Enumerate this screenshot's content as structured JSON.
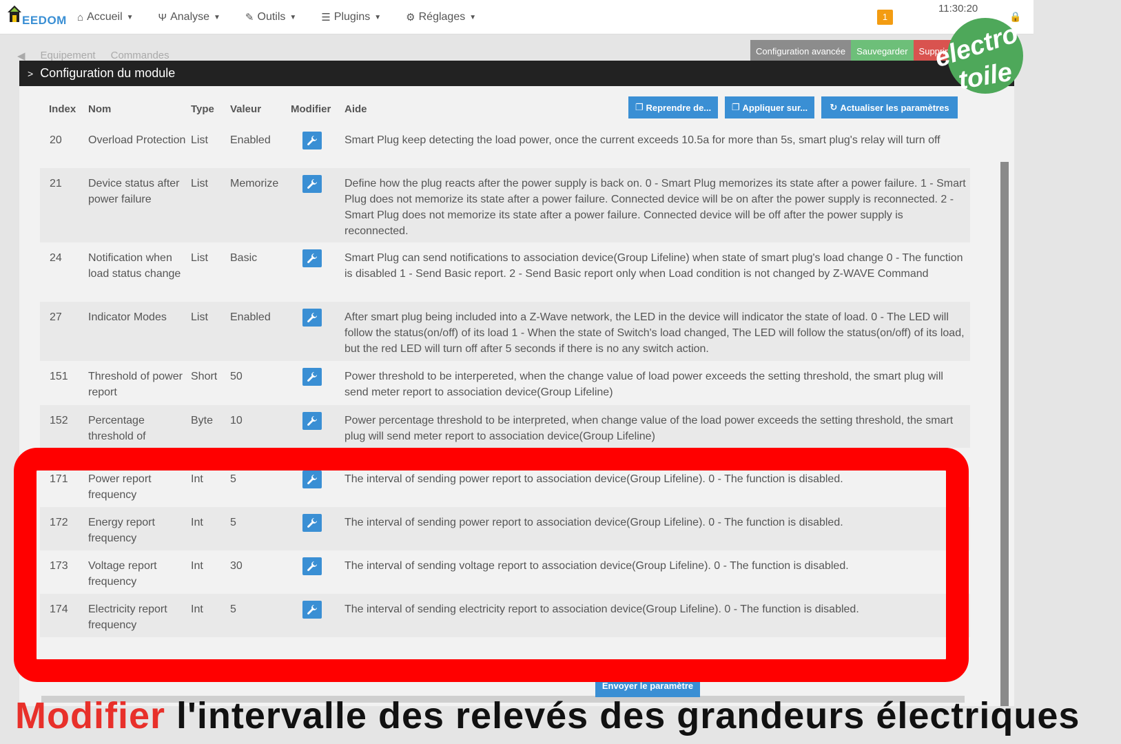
{
  "navbar": {
    "brand": "EEDOM",
    "menu": [
      {
        "label": "Accueil",
        "icon": "home-icon"
      },
      {
        "label": "Analyse",
        "icon": "stethoscope-icon"
      },
      {
        "label": "Outils",
        "icon": "wrench-icon"
      },
      {
        "label": "Plugins",
        "icon": "list-icon"
      },
      {
        "label": "Réglages",
        "icon": "gear-icon"
      }
    ],
    "notification_count": "1",
    "time": "11:30:20"
  },
  "background": {
    "tabs": [
      "Equipement",
      "Commandes"
    ],
    "buttons": [
      "Configuration avancée",
      "Sauvegarder",
      "Supprimer"
    ]
  },
  "modal": {
    "title": "Configuration du module",
    "columns": {
      "index": "Index",
      "nom": "Nom",
      "type": "Type",
      "valeur": "Valeur",
      "modifier": "Modifier",
      "aide": "Aide"
    },
    "actions": {
      "reprendre": "Reprendre de...",
      "appliquer": "Appliquer sur...",
      "actualiser": "Actualiser les paramètres"
    },
    "rows": [
      {
        "index": "20",
        "nom": "Overload Protection",
        "type": "List",
        "valeur": "Enabled",
        "aide": "Smart Plug keep detecting the load power, once the current exceeds 10.5a for more than 5s, smart plug's relay will turn off"
      },
      {
        "index": "21",
        "nom": "Device status after power failure",
        "type": "List",
        "valeur": "Memorize",
        "aide": "Define how the plug reacts after the power supply is back on. 0 - Smart Plug memorizes its state after a power failure. 1 - Smart Plug does not memorize its state after a power failure. Connected device will be on after the power supply is reconnected. 2 - Smart Plug does not memorize its state after a power failure. Connected device will be off after the power supply is reconnected."
      },
      {
        "index": "24",
        "nom": "Notification when load status change",
        "type": "List",
        "valeur": "Basic",
        "aide": "Smart Plug can send notifications to association device(Group Lifeline) when state of smart plug's load change 0 - The function is disabled 1 - Send Basic report. 2 - Send Basic report only when Load condition is not changed by Z-WAVE Command"
      },
      {
        "index": "27",
        "nom": "Indicator Modes",
        "type": "List",
        "valeur": "Enabled",
        "aide": "After smart plug being included into a Z-Wave network, the LED in the device will indicator the state of load. 0 - The LED will follow the status(on/off) of its load 1 - When the state of Switch's load changed, The LED will follow the status(on/off) of its load, but the red LED will turn off after 5 seconds if there is no any switch action."
      },
      {
        "index": "151",
        "nom": "Threshold of power report",
        "type": "Short",
        "valeur": "50",
        "aide": "Power threshold to be interpereted, when the change value of load power exceeds the setting threshold, the smart plug will send meter report to association device(Group Lifeline)"
      },
      {
        "index": "152",
        "nom": "Percentage threshold of",
        "type": "Byte",
        "valeur": "10",
        "aide": "Power percentage threshold to be interpreted, when change value of the load power exceeds the setting threshold, the smart plug will send meter report to association device(Group Lifeline)"
      },
      {
        "index": "171",
        "nom": "Power report frequency",
        "type": "Int",
        "valeur": "5",
        "aide": "The interval of sending power report to association device(Group Lifeline). 0 - The function is disabled."
      },
      {
        "index": "172",
        "nom": "Energy report frequency",
        "type": "Int",
        "valeur": "5",
        "aide": "The interval of sending power report to association device(Group Lifeline). 0 - The function is disabled."
      },
      {
        "index": "173",
        "nom": "Voltage report frequency",
        "type": "Int",
        "valeur": "30",
        "aide": "The interval of sending voltage report to association device(Group Lifeline). 0 - The function is disabled."
      },
      {
        "index": "174",
        "nom": "Electricity report frequency",
        "type": "Int",
        "valeur": "5",
        "aide": "The interval of sending electricity report to association device(Group Lifeline). 0 - The function is disabled."
      }
    ],
    "send_button": "Envoyer le paramètre"
  },
  "watermark": {
    "line1": "electro",
    "line2": "toile"
  },
  "caption": {
    "highlight": "Modifier",
    "rest": " l'intervalle des relevés des grandeurs électriques"
  },
  "colors": {
    "accent": "#3a8fd4",
    "highlight": "#ff0000",
    "notification": "#f39c12"
  }
}
